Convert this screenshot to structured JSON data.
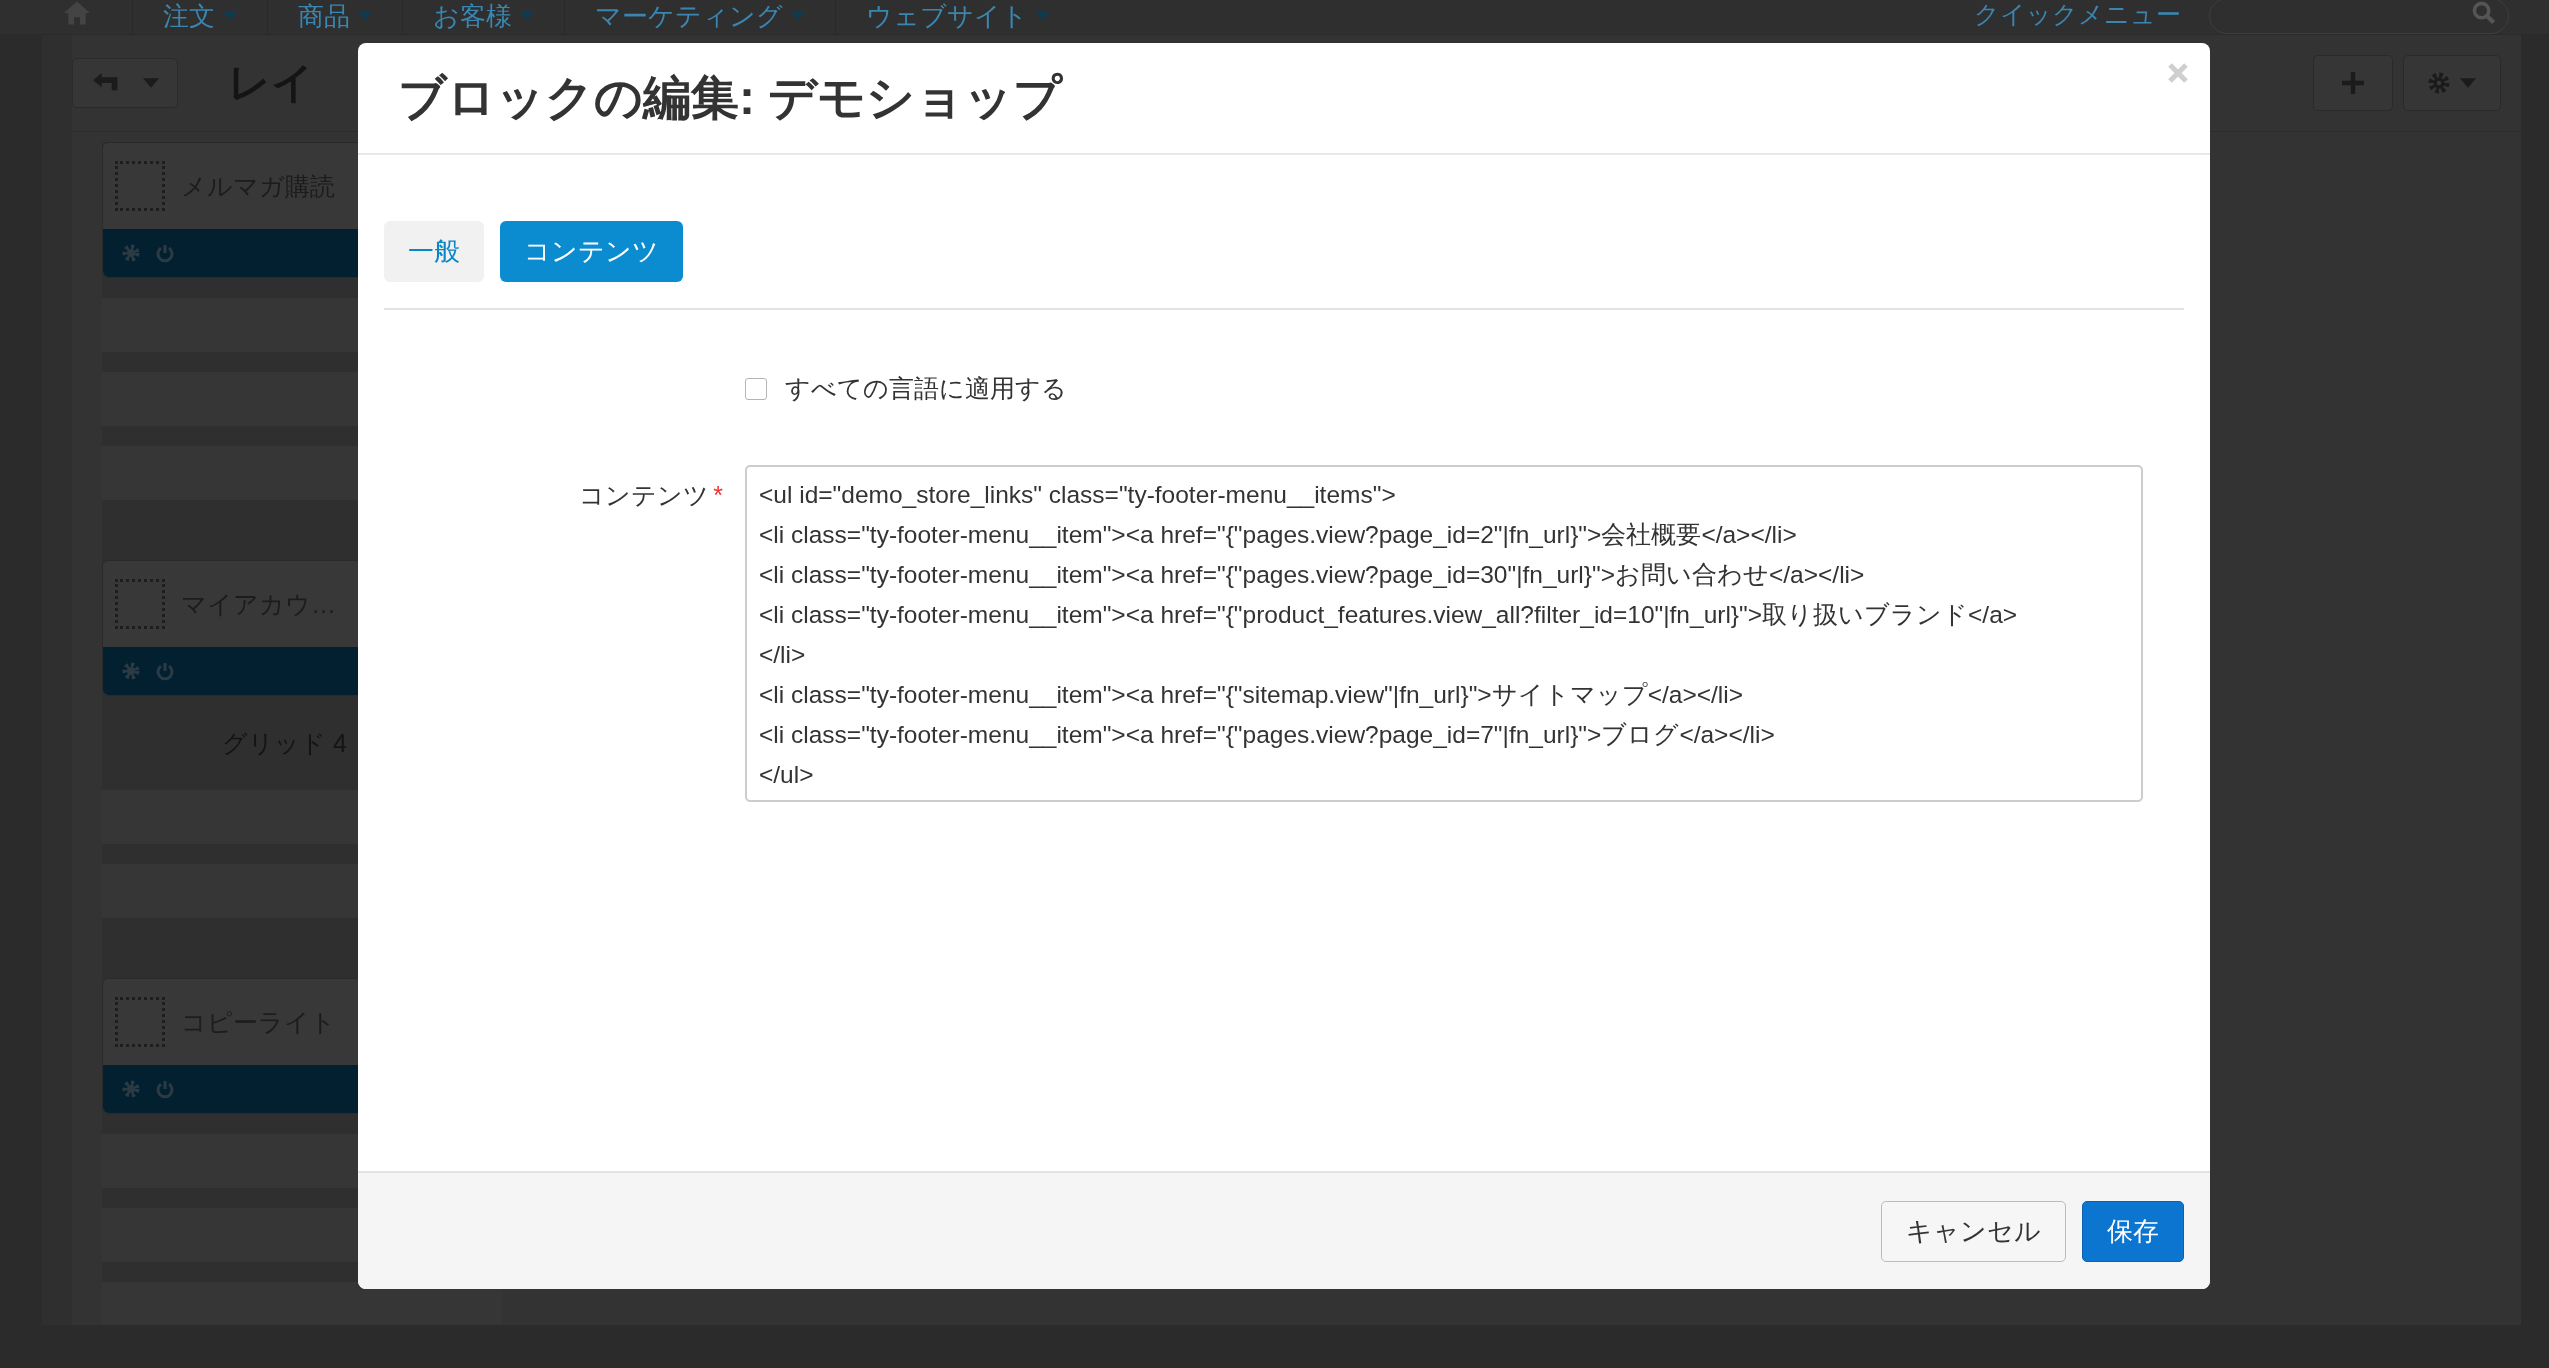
{
  "navbar": {
    "items": [
      {
        "label": "注文"
      },
      {
        "label": "商品"
      },
      {
        "label": "お客様"
      },
      {
        "label": "マーケティング"
      },
      {
        "label": "ウェブサイト"
      }
    ],
    "quick_menu": "クイックメニュー"
  },
  "toolbar": {
    "title": "レイ"
  },
  "blocks": [
    {
      "title": "メルマガ購読"
    },
    {
      "title": "マイアカウ…",
      "grid_label": "グリッド 4"
    },
    {
      "title": "コピーライト"
    }
  ],
  "modal": {
    "title": "ブロックの編集: デモショップ",
    "tabs": [
      {
        "label": "一般",
        "selected": false
      },
      {
        "label": "コンテンツ",
        "selected": true
      }
    ],
    "apply_all": {
      "label": "すべての言語に適用する",
      "checked": false
    },
    "content_field": {
      "label": "コンテンツ",
      "required_mark": "*",
      "value_lines": [
        "<ul id=\"demo_store_links\" class=\"ty-footer-menu__items\">",
        "<li class=\"ty-footer-menu__item\"><a href=\"{\"pages.view?page_id=2\"|fn_url}\">会社概要</a></li>",
        "<li class=\"ty-footer-menu__item\"><a href=\"{\"pages.view?page_id=30\"|fn_url}\">お問い合わせ</a></li>",
        "<li class=\"ty-footer-menu__item\"><a href=\"{\"product_features.view_all?filter_id=10\"|fn_url}\">取り扱いブランド</a>",
        "</li>",
        "<li class=\"ty-footer-menu__item\"><a href=\"{\"sitemap.view\"|fn_url}\">サイトマップ</a></li>",
        "<li class=\"ty-footer-menu__item\"><a href=\"{\"pages.view?page_id=7\"|fn_url}\">ブログ</a></li>",
        "</ul>"
      ]
    },
    "buttons": {
      "cancel": "キャンセル",
      "save": "保存"
    }
  }
}
